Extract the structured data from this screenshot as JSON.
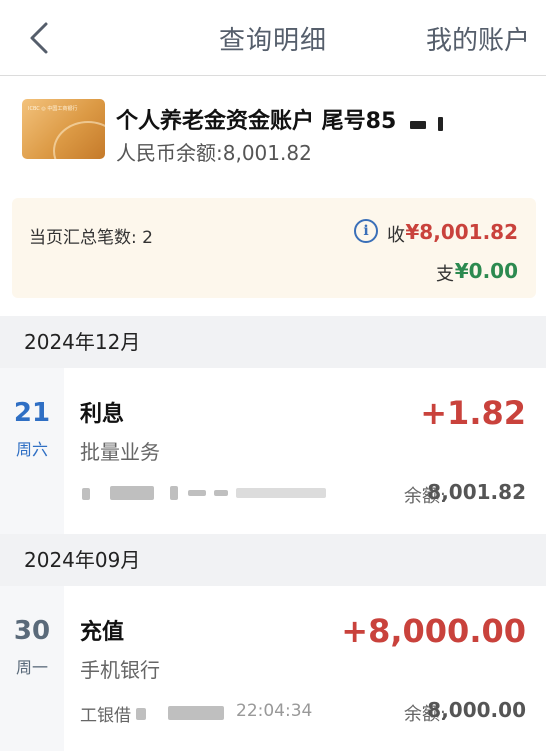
{
  "header": {
    "back_icon": "chevron-left-icon",
    "title": "查询明细",
    "my_account": "我的账户"
  },
  "account": {
    "card_label": "ICBC 中国工商银行",
    "name": "个人养老金资金账户  尾号85",
    "balance_text": "人民币余额:8,001.82"
  },
  "summary": {
    "count_text": "当页汇总笔数: 2",
    "info_icon": "info-icon",
    "in_label": "收",
    "in_amount": "¥8,001.82",
    "out_label": "支",
    "out_amount": "¥0.00",
    "colors": {
      "income": "#c9423c",
      "expense": "#2c8a50",
      "info": "#3a6fb8"
    }
  },
  "groups": [
    {
      "month": "2024年12月",
      "transactions": [
        {
          "day": "21",
          "weekday": "周六",
          "day_color": "#2f6fc4",
          "title": "利息",
          "amount": "+1.82",
          "channel": "批量业务",
          "balance_label": "余额:",
          "balance": "8,001.82"
        }
      ]
    },
    {
      "month": "2024年09月",
      "transactions": [
        {
          "day": "30",
          "weekday": "周一",
          "day_color": "#5a6a7a",
          "title": "充值",
          "amount": "+8,000.00",
          "channel": "手机银行",
          "sub_prefix": "工银借",
          "time": "22:04:34",
          "balance_label": "余额:",
          "balance": "8,000.00"
        }
      ]
    }
  ]
}
